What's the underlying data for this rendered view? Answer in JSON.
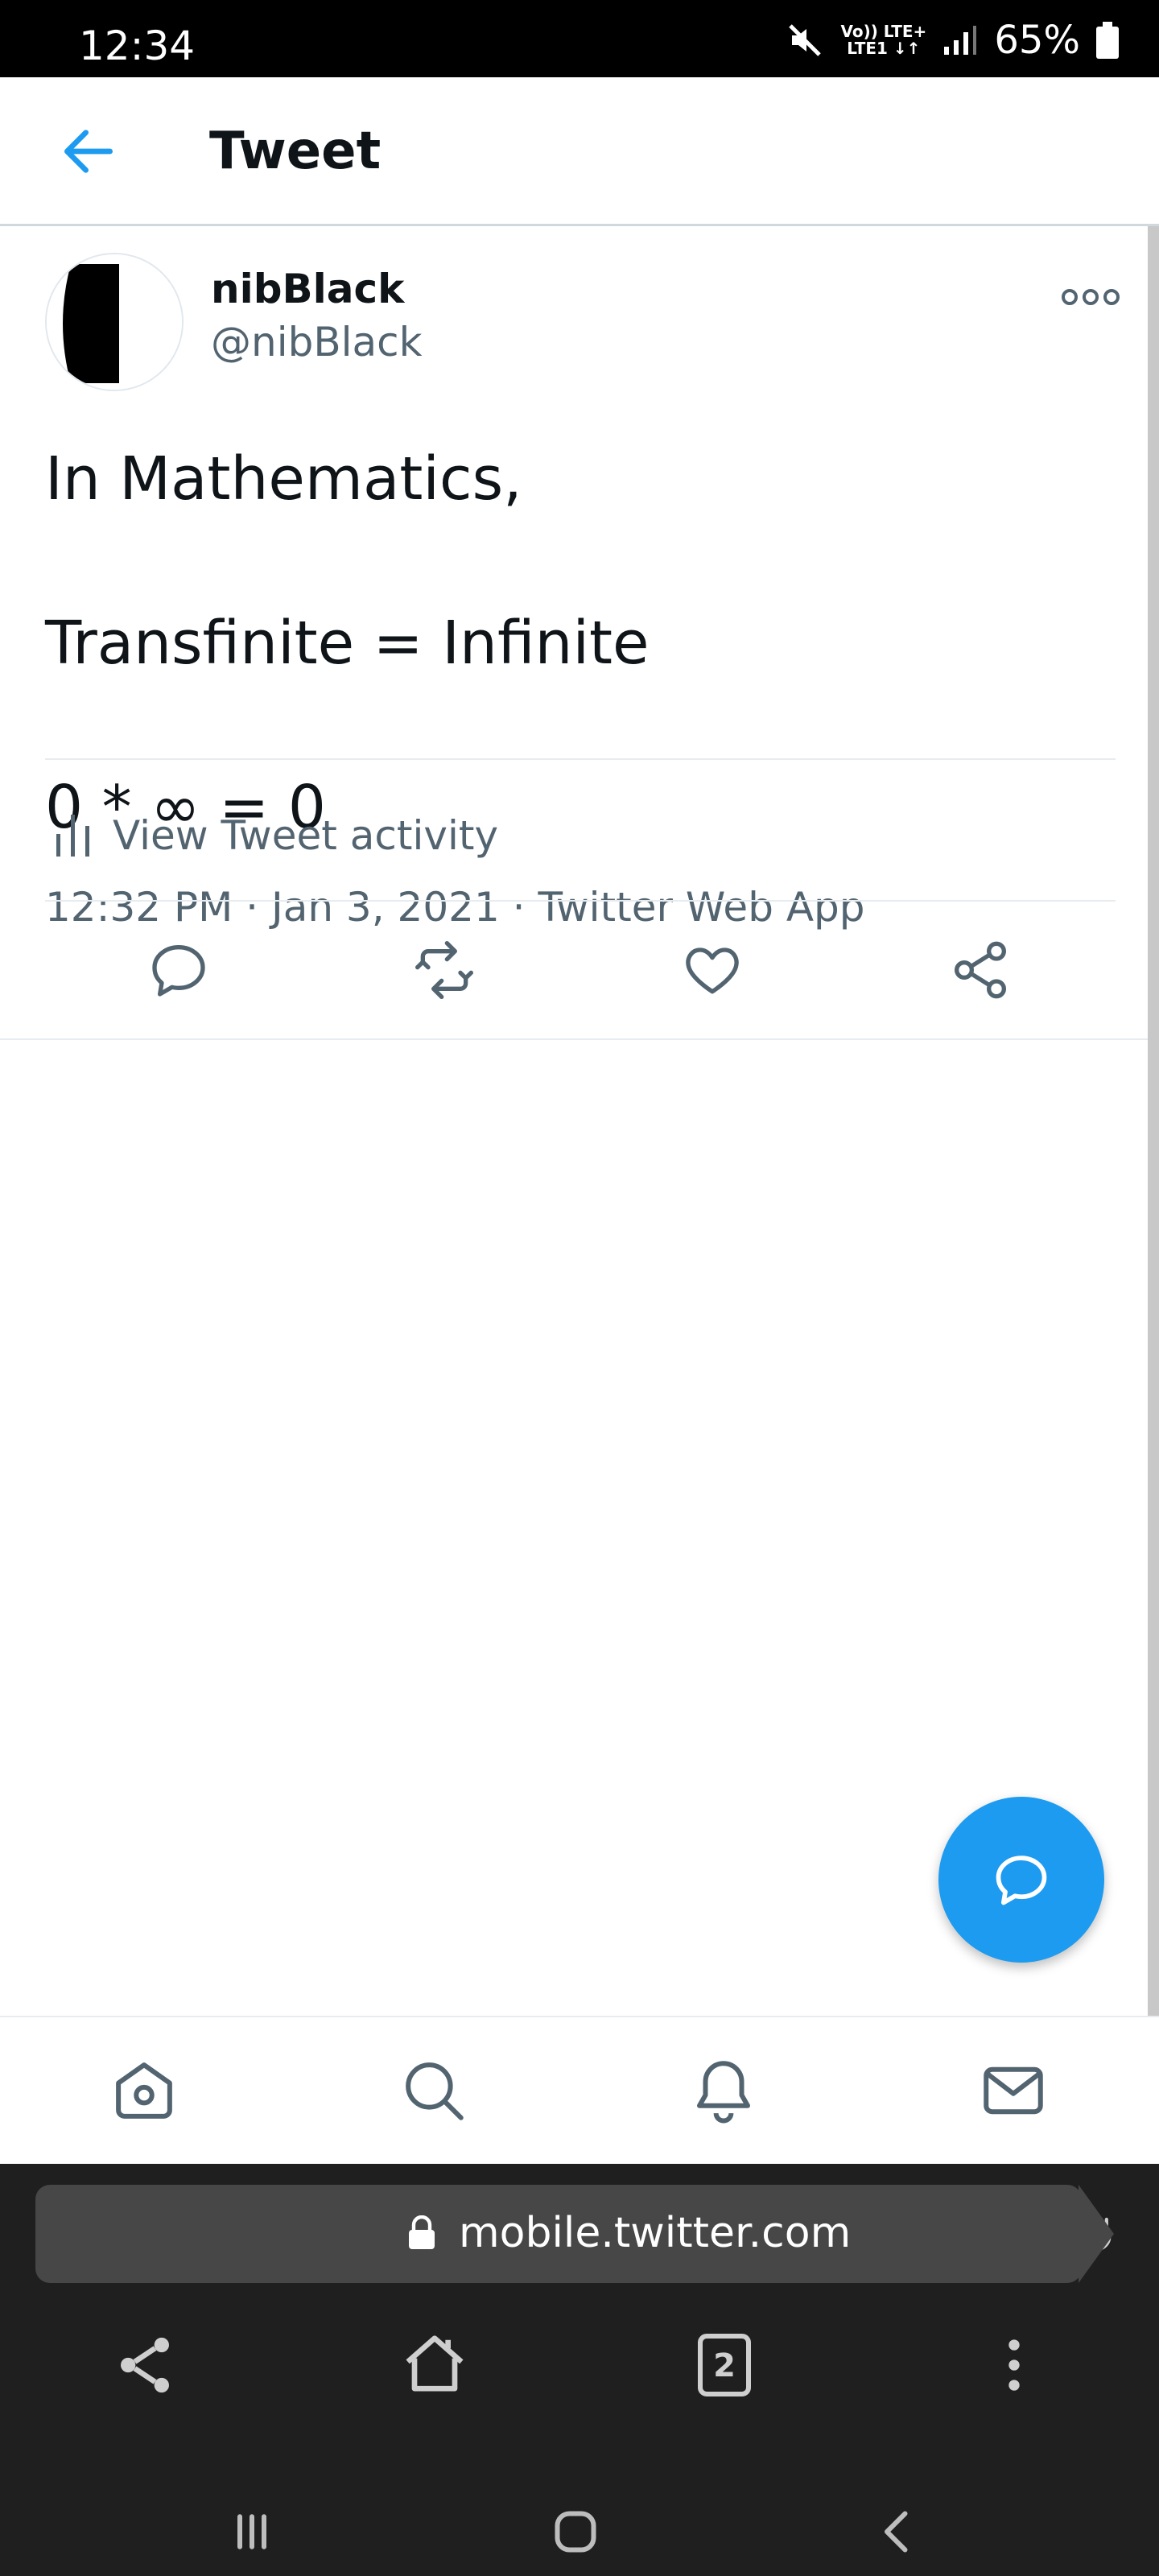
{
  "status_bar": {
    "time": "12:34",
    "network_top": "Vo)) LTE+",
    "network_bottom": "LTE1 ↓↑",
    "battery": "65%"
  },
  "header": {
    "title": "Tweet"
  },
  "tweet": {
    "display_name": "nibBlack",
    "handle": "@nibBlack",
    "text_lines": [
      "In Mathematics,",
      "",
      "Transfinite = Infinite",
      "",
      "0 * ∞ = 0"
    ],
    "meta": "12:32 PM · Jan 3, 2021 · Twitter Web App",
    "activity_label": "View Tweet activity"
  },
  "icons": {
    "back": "arrow-left-icon",
    "more": "more-options-icon",
    "activity": "bar-chart-icon",
    "reply": "reply-icon",
    "retweet": "retweet-icon",
    "like": "heart-icon",
    "share": "share-icon",
    "compose": "compose-reply-icon",
    "home": "home-icon",
    "search": "search-icon",
    "notifications": "bell-icon",
    "messages": "mail-icon"
  },
  "browser": {
    "url": "mobile.twitter.com",
    "tab_count": "2"
  },
  "colors": {
    "accent": "#1d9bf0",
    "secondary_text": "#536471",
    "icon_gray": "#536471"
  }
}
